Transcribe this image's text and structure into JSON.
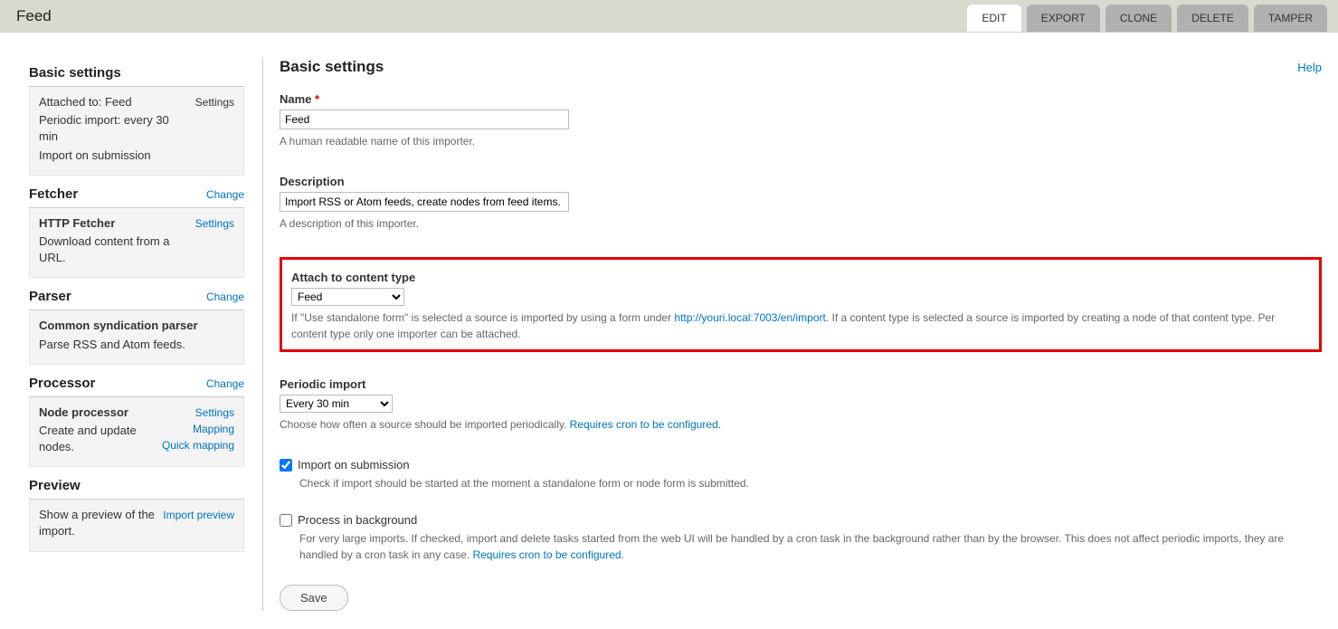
{
  "topbar": {
    "title": "Feed",
    "tabs": [
      "EDIT",
      "EXPORT",
      "CLONE",
      "DELETE",
      "TAMPER"
    ],
    "active_tab": 0
  },
  "sidebar": {
    "basic": {
      "title": "Basic settings",
      "action": "Settings",
      "lines": [
        "Attached to: Feed",
        "Periodic import: every 30 min",
        "Import on submission"
      ]
    },
    "fetcher": {
      "title": "Fetcher",
      "change": "Change",
      "name": "HTTP Fetcher",
      "desc": "Download content from a URL.",
      "action": "Settings"
    },
    "parser": {
      "title": "Parser",
      "change": "Change",
      "name": "Common syndication parser",
      "desc": "Parse RSS and Atom feeds."
    },
    "processor": {
      "title": "Processor",
      "change": "Change",
      "name": "Node processor",
      "desc": "Create and update nodes.",
      "actions": [
        "Settings",
        "Mapping",
        "Quick mapping"
      ]
    },
    "preview": {
      "title": "Preview",
      "desc": "Show a preview of the import.",
      "action": "Import preview"
    }
  },
  "main": {
    "title": "Basic settings",
    "help": "Help",
    "name": {
      "label": "Name",
      "value": "Feed",
      "desc": "A human readable name of this importer."
    },
    "description": {
      "label": "Description",
      "value": "Import RSS or Atom feeds, create nodes from feed items.",
      "desc": "A description of this importer."
    },
    "attach": {
      "label": "Attach to content type",
      "value": "Feed",
      "desc_before": "If \"Use standalone form\" is selected a source is imported by using a form under ",
      "link": "http://youri.local:7003/en/import",
      "desc_after": ". If a content type is selected a source is imported by creating a node of that content type. Per content type only one importer can be attached."
    },
    "periodic": {
      "label": "Periodic import",
      "value": "Every 30 min",
      "desc_before": "Choose how often a source should be imported periodically. ",
      "link": "Requires cron to be configured."
    },
    "import_on_submission": {
      "label": "Import on submission",
      "checked": true,
      "desc": "Check if import should be started at the moment a standalone form or node form is submitted."
    },
    "process_bg": {
      "label": "Process in background",
      "checked": false,
      "desc_before": "For very large imports. If checked, import and delete tasks started from the web UI will be handled by a cron task in the background rather than by the browser. This does not affect periodic imports, they are handled by a cron task in any case. ",
      "link": "Requires cron to be configured."
    },
    "save": "Save"
  }
}
